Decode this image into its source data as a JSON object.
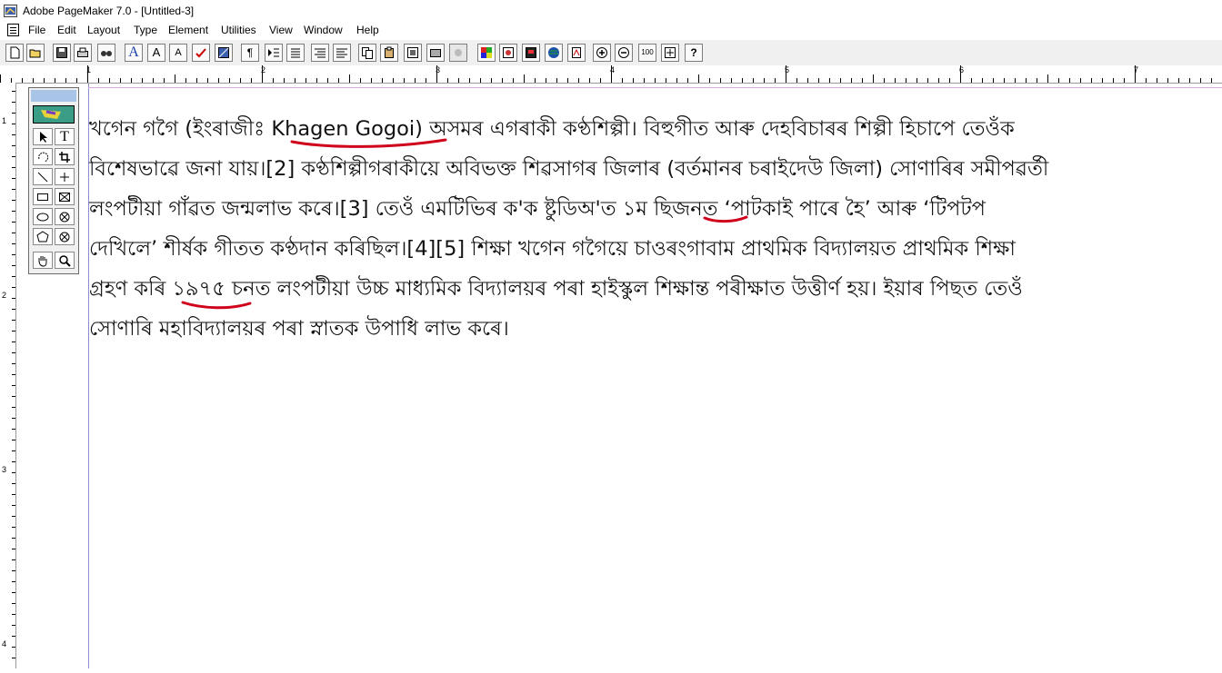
{
  "window": {
    "title": "Adobe PageMaker 7.0 - [Untitled-3]"
  },
  "menu": [
    "File",
    "Edit",
    "Layout",
    "Type",
    "Element",
    "Utilities",
    "View",
    "Window",
    "Help"
  ],
  "toolbar": {
    "buttons": [
      "new-icon",
      "open-icon",
      "save-icon",
      "print-icon",
      "find-icon",
      "font-icon",
      "font-size-up-icon",
      "font-size-down-icon",
      "spell-check-icon",
      "fill-icon",
      "paragraph-icon",
      "indent-icon",
      "list-icon",
      "outdent-icon",
      "indent-right-icon",
      "copy-icon",
      "paste-icon",
      "frame-icon",
      "image-icon",
      "link-icon",
      "color-icon",
      "place-icon",
      "export-icon",
      "globe-icon",
      "pdf-icon",
      "zoom-in-icon",
      "zoom-out-icon",
      "actual-size-icon",
      "fit-icon",
      "help-icon"
    ],
    "text_labels": {
      "font": "A",
      "font_up": "A",
      "font_down": "A",
      "paragraph": "¶",
      "actual_size": "100",
      "help": "?"
    }
  },
  "rulers": {
    "h_labels": [
      "1",
      "2",
      "3",
      "4",
      "5",
      "6",
      "7"
    ],
    "v_labels": [
      "1",
      "2",
      "3",
      "4"
    ]
  },
  "toolbox": {
    "tools": [
      "pointer-tool",
      "text-tool",
      "rotate-tool",
      "crop-tool",
      "line-tool",
      "constrained-line-tool",
      "rectangle-tool",
      "rectangle-frame-tool",
      "ellipse-tool",
      "ellipse-frame-tool",
      "polygon-tool",
      "polygon-frame-tool",
      "hand-tool",
      "zoom-tool"
    ],
    "text_tool_label": "T"
  },
  "document": {
    "lines": [
      "খগেন গগৈ (ইংৰাজীঃ Khagen Gogoi) অসমৰ এগৰাকী কণ্ঠশিল্পী। বিহুগীত আৰু দেহবিচাৰৰ শিল্পী হিচাপে তেওঁক",
      "বিশেষভাৱে জনা যায়।[2] কণ্ঠশিল্পীগৰাকীয়ে অবিভক্ত শিৱসাগৰ জিলাৰ (বৰ্তমানৰ চৰাইদেউ জিলা) সোণাৰিৰ সমীপৱৰ্তী",
      "লংপটীয়া গাঁৱত জন্মলাভ কৰে।[3] তেওঁ এমটিভিৰ ক'ক ষ্টুডিঅ'ত ১ম ছিজনত ‘পাটকাই পাৰে হৈ’ আৰু ‘টিপটপ",
      "দেখিলে’ শীৰ্ষক গীতত কণ্ঠদান কৰিছিল।[4][5] শিক্ষা খগেন গগৈয়ে চাওৰংগাবাম প্ৰাথমিক বিদ্যালয়ত প্ৰাথমিক শিক্ষা",
      "গ্ৰহণ কৰি ১৯৭৫ চনত লংপটীয়া উচ্চ মাধ্যমিক বিদ্যালয়ৰ পৰা হাইস্কুল শিক্ষান্ত পৰীক্ষাত উত্তীৰ্ণ হয়। ইয়াৰ পিছত তেওঁ",
      "সোণাৰি মহাবিদ্যালয়ৰ পৰা স্নাতক উপাধি লাভ কৰে।"
    ],
    "annotation_color": "#d0021b"
  }
}
